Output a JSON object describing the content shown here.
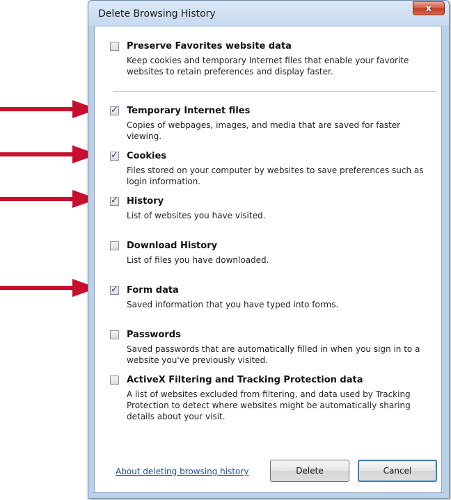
{
  "window": {
    "title": "Delete Browsing History",
    "close_glyph": "x"
  },
  "options": [
    {
      "id": "preserve-favorites",
      "label": "Preserve Favorites website data",
      "description": "Keep cookies and temporary Internet files that enable your favorite websites to retain preferences and display faster.",
      "checked": false
    },
    {
      "id": "temporary-internet-files",
      "label": "Temporary Internet files",
      "description": "Copies of webpages, images, and media that are saved for faster viewing.",
      "checked": true
    },
    {
      "id": "cookies",
      "label": "Cookies",
      "description": "Files stored on your computer by websites to save preferences such as login information.",
      "checked": true
    },
    {
      "id": "history",
      "label": "History",
      "description": "List of websites you have visited.",
      "checked": true
    },
    {
      "id": "download-history",
      "label": "Download History",
      "description": "List of files you have downloaded.",
      "checked": false
    },
    {
      "id": "form-data",
      "label": "Form data",
      "description": "Saved information that you have typed into forms.",
      "checked": true
    },
    {
      "id": "passwords",
      "label": "Passwords",
      "description": "Saved passwords that are automatically filled in when you sign in to a website you've previously visited.",
      "checked": false
    },
    {
      "id": "activex-filtering",
      "label": "ActiveX Filtering and Tracking Protection data",
      "description": "A list of websites excluded from filtering, and data used by Tracking Protection to detect where websites might be automatically sharing details about your visit.",
      "checked": false
    }
  ],
  "footer": {
    "link": "About deleting browsing history",
    "delete_label": "Delete",
    "cancel_label": "Cancel"
  },
  "check_glyph": "✓",
  "colors": {
    "annotation_arrow": "#c8102e",
    "link": "#1a4fa8",
    "checkmark": "#1c3f82"
  },
  "icons": {
    "close": "close-icon",
    "check": "checkmark-icon",
    "annotation": "red-arrow-icon"
  }
}
